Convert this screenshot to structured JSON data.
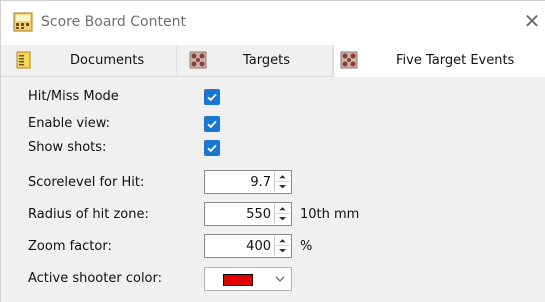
{
  "window": {
    "title": "Score Board Content",
    "app_icon": "scoreboard-icon",
    "close_icon": "close-icon"
  },
  "tabs": [
    {
      "label": "Documents",
      "icon": "document-icon",
      "active": false
    },
    {
      "label": "Targets",
      "icon": "target-icon",
      "active": false
    },
    {
      "label": "Five Target Events",
      "icon": "target-icon",
      "active": true
    }
  ],
  "form": {
    "hit_miss_mode": {
      "label": "Hit/Miss Mode",
      "checked": true
    },
    "enable_view": {
      "label": "Enable view:",
      "checked": true
    },
    "show_shots": {
      "label": "Show shots:",
      "checked": true
    },
    "scorelevel": {
      "label": "Scorelevel for Hit:",
      "value": "9.7"
    },
    "radius": {
      "label": "Radius of hit zone:",
      "value": "550",
      "unit": "10th mm"
    },
    "zoom": {
      "label": "Zoom factor:",
      "value": "400",
      "unit": "%"
    },
    "active_color": {
      "label": "Active shooter color:",
      "color": "#e00000"
    }
  },
  "colors": {
    "check_accent": "#1976d2",
    "active_shooter": "#e00000"
  }
}
